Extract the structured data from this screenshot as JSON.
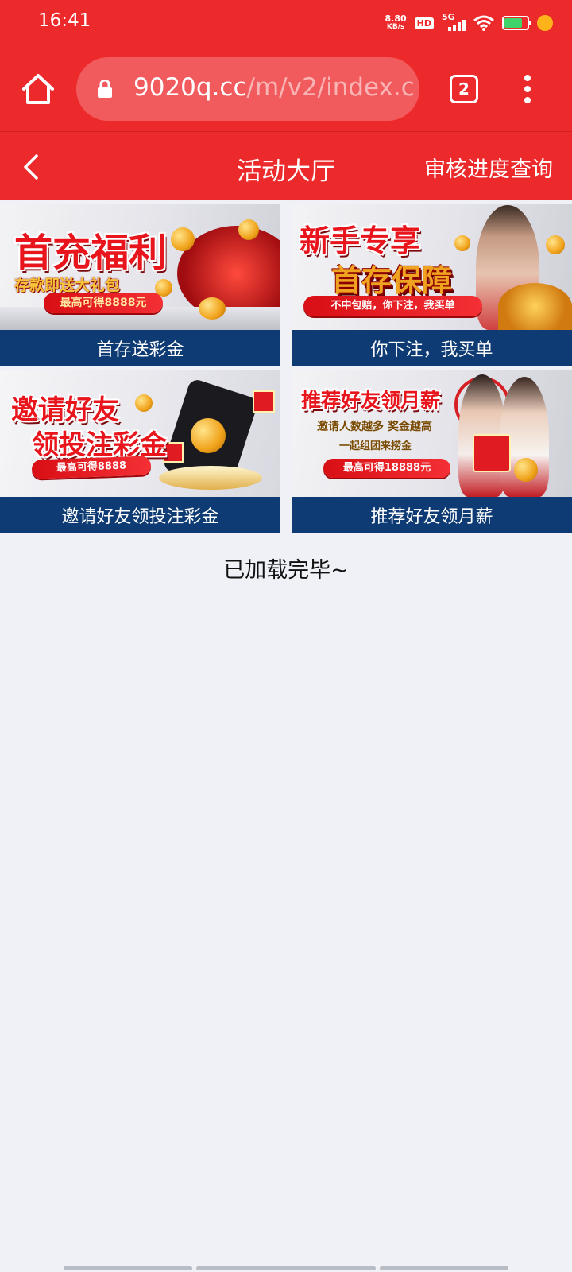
{
  "status_bar": {
    "time": "16:41",
    "net_speed_value": "8.80",
    "net_speed_unit": "KB/s",
    "hd": "HD",
    "network": "5G",
    "battery_color": "#3fd36a"
  },
  "browser": {
    "url_domain": "9020q.cc",
    "url_path": "/m/v2/index.c",
    "tab_count": "2",
    "icons": [
      "home-icon",
      "lock-icon",
      "tabs-icon",
      "more-vert-icon"
    ]
  },
  "header": {
    "title": "活动大厅",
    "right_link": "审核进度查询",
    "back_icon": "chevron-left-icon"
  },
  "promos": [
    {
      "label": "首存送彩金",
      "banner": {
        "headline": "首充福利",
        "sub": "存款即送大礼包",
        "ribbon": "最高可得8888元"
      }
    },
    {
      "label": "你下注，我买单",
      "banner": {
        "headline": "新手专享",
        "sub": "首存保障",
        "ribbon": "不中包赔，你下注，我买单"
      }
    },
    {
      "label": "邀请好友领投注彩金",
      "banner": {
        "headline": "邀请好友",
        "sub": "领投注彩金",
        "ribbon": "最高可得8888"
      }
    },
    {
      "label": "推荐好友领月薪",
      "banner": {
        "headline": "推荐好友领月薪",
        "sub": "邀请人数越多 奖金越高",
        "sub2": "一起组团来捞金",
        "ribbon": "最高可得18888元"
      }
    }
  ],
  "footer": {
    "loaded": "已加载完毕~"
  },
  "colors": {
    "brand_red": "#ec2a2c",
    "label_navy": "#0e3b73",
    "background": "#eff1f6"
  }
}
